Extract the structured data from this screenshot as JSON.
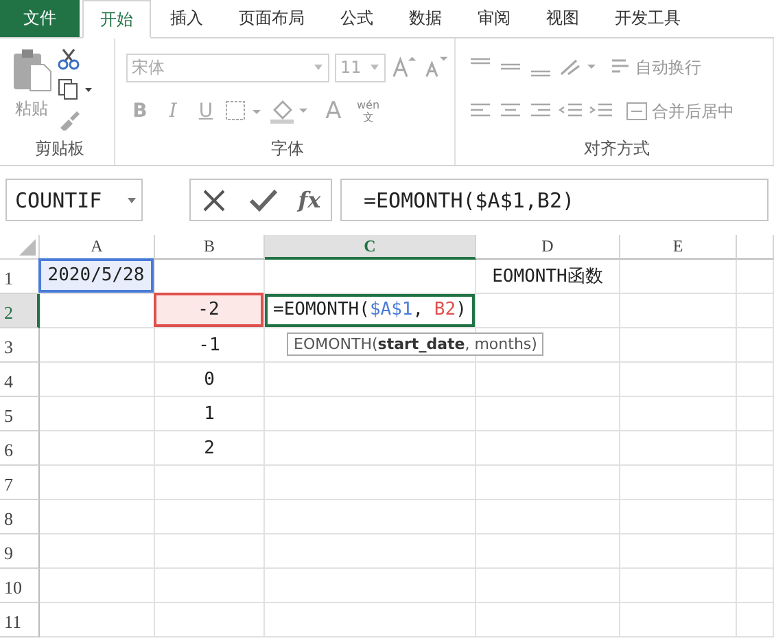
{
  "tabs": [
    {
      "label": "文件",
      "kind": "file",
      "selected": false
    },
    {
      "label": "开始",
      "kind": "tab",
      "selected": true
    },
    {
      "label": "插入",
      "kind": "tab",
      "selected": false
    },
    {
      "label": "页面布局",
      "kind": "tab",
      "selected": false
    },
    {
      "label": "公式",
      "kind": "tab",
      "selected": false
    },
    {
      "label": "数据",
      "kind": "tab",
      "selected": false
    },
    {
      "label": "审阅",
      "kind": "tab",
      "selected": false
    },
    {
      "label": "视图",
      "kind": "tab",
      "selected": false
    },
    {
      "label": "开发工具",
      "kind": "tab",
      "selected": false
    }
  ],
  "ribbon": {
    "disabled": true,
    "clipboard": {
      "label": "剪贴板",
      "paste": "粘贴"
    },
    "font": {
      "label": "字体",
      "font_name": "宋体",
      "font_size": "11",
      "bold": "B",
      "italic": "I",
      "underline": "U",
      "font_color": "A",
      "phonetic_top": "wén",
      "phonetic_bottom": "文"
    },
    "alignment": {
      "label": "对齐方式",
      "wrap": "自动换行",
      "merge": "合并后居中"
    }
  },
  "formula_bar": {
    "name_box": "COUNTIF",
    "fx": "fx",
    "formula": "=EOMONTH($A$1,B2)"
  },
  "columns": [
    {
      "label": "A",
      "selected": false
    },
    {
      "label": "B",
      "selected": false
    },
    {
      "label": "C",
      "selected": true
    },
    {
      "label": "D",
      "selected": false
    },
    {
      "label": "E",
      "selected": false
    }
  ],
  "rows": [
    {
      "number": "1",
      "selected": false,
      "cells": [
        {
          "text": "2020/5/28",
          "color": "#4a7bd8"
        },
        {
          "text": ""
        },
        {
          "text": ""
        },
        {
          "text": "EOMONTH函数"
        },
        {
          "text": ""
        }
      ]
    },
    {
      "number": "2",
      "selected": true,
      "cells": [
        {
          "text": ""
        },
        {
          "text": "-2",
          "color": "#e0504d"
        },
        {
          "kind": "editing",
          "parts": [
            {
              "text": "=EOMONTH("
            },
            {
              "text": "$A$1",
              "color": "#4a7bd8"
            },
            {
              "text": ", "
            },
            {
              "text": "B2",
              "color": "#e0504d"
            },
            {
              "text": ")"
            }
          ]
        },
        {
          "text": ""
        },
        {
          "text": ""
        }
      ]
    },
    {
      "number": "3",
      "selected": false,
      "cells": [
        {
          "text": ""
        },
        {
          "text": "-1"
        },
        {
          "text": ""
        },
        {
          "text": ""
        },
        {
          "text": ""
        }
      ]
    },
    {
      "number": "4",
      "selected": false,
      "cells": [
        {
          "text": ""
        },
        {
          "text": "0"
        },
        {
          "text": ""
        },
        {
          "text": ""
        },
        {
          "text": ""
        }
      ]
    },
    {
      "number": "5",
      "selected": false,
      "cells": [
        {
          "text": ""
        },
        {
          "text": "1"
        },
        {
          "text": ""
        },
        {
          "text": ""
        },
        {
          "text": ""
        }
      ]
    },
    {
      "number": "6",
      "selected": false,
      "cells": [
        {
          "text": ""
        },
        {
          "text": "2"
        },
        {
          "text": ""
        },
        {
          "text": ""
        },
        {
          "text": ""
        }
      ]
    },
    {
      "number": "7",
      "selected": false,
      "cells": [
        {
          "text": ""
        },
        {
          "text": ""
        },
        {
          "text": ""
        },
        {
          "text": ""
        },
        {
          "text": ""
        }
      ]
    },
    {
      "number": "8",
      "selected": false,
      "cells": [
        {
          "text": ""
        },
        {
          "text": ""
        },
        {
          "text": ""
        },
        {
          "text": ""
        },
        {
          "text": ""
        }
      ]
    },
    {
      "number": "9",
      "selected": false,
      "cells": [
        {
          "text": ""
        },
        {
          "text": ""
        },
        {
          "text": ""
        },
        {
          "text": ""
        },
        {
          "text": ""
        }
      ]
    },
    {
      "number": "10",
      "selected": false,
      "cells": [
        {
          "text": ""
        },
        {
          "text": ""
        },
        {
          "text": ""
        },
        {
          "text": ""
        },
        {
          "text": ""
        }
      ]
    },
    {
      "number": "11",
      "selected": false,
      "cells": [
        {
          "text": ""
        },
        {
          "text": ""
        },
        {
          "text": ""
        },
        {
          "text": ""
        },
        {
          "text": ""
        }
      ]
    }
  ],
  "tooltip": "EOMONTH(**start_date**, months)"
}
